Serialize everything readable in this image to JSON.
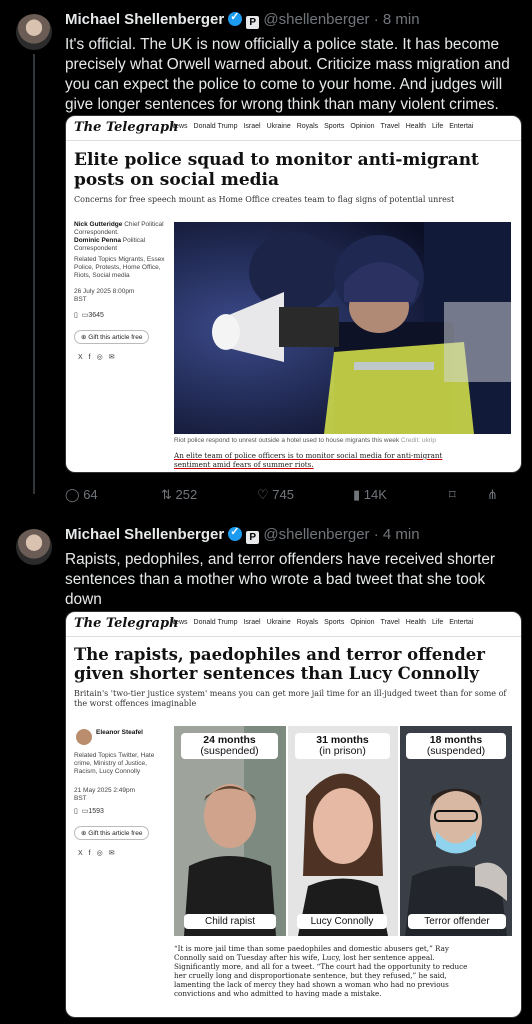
{
  "tweet1": {
    "name": "Michael Shellenberger",
    "badge": "P",
    "handle": "@shellenberger",
    "dot": "·",
    "time": "8 min",
    "text": "It's official. The UK is now officially a police state. It has become precisely what Orwell warned about. Criticize mass migration and you can expect the police to come to your home. And judges will give longer sentences for wrong think than many violent crimes.",
    "article": {
      "logo": "The Telegraph",
      "nav": [
        "News",
        "Donald Trump",
        "Israel",
        "Ukraine",
        "Royals",
        "Sports",
        "Opinion",
        "Travel",
        "Health",
        "Life",
        "Entertai"
      ],
      "headline": "Elite police squad to monitor anti-migrant posts on social media",
      "standfirst": "Concerns for free speech mount as Home Office creates team to flag signs of potential unrest",
      "author1": "Nick Gutteridge",
      "author1_role": "Chief Political Correspondent.",
      "author2": "Dominic Penna",
      "author2_role": "Political Correspondent",
      "topics": "Related Topics Migrants, Essex Police, Protests, Home Office, Riots, Social media",
      "date": "26 July 2025 8:00pm BST",
      "comments": "3645",
      "gift": "Gift this article free",
      "caption": "Riot police respond to unrest outside a hotel used to house migrants this week",
      "credit": "Credit: ukrip",
      "lede": "An elite team of police officers is to monitor social media for anti-migrant sentiment amid fears of summer riots."
    },
    "actions": {
      "replies": "64",
      "reposts": "252",
      "likes": "745",
      "views": "14K"
    }
  },
  "tweet2": {
    "name": "Michael Shellenberger",
    "badge": "P",
    "handle": "@shellenberger",
    "dot": "·",
    "time": "4 min",
    "text": "Rapists, pedophiles, and terror offenders have received shorter sentences than a mother  who wrote a bad tweet that she took down",
    "article": {
      "logo": "The Telegraph",
      "nav": [
        "News",
        "Donald Trump",
        "Israel",
        "Ukraine",
        "Royals",
        "Sports",
        "Opinion",
        "Travel",
        "Health",
        "Life",
        "Entertai"
      ],
      "headline": "The rapists, paedophiles and terror offender given shorter sentences than Lucy Connolly",
      "standfirst": "Britain's 'two-tier justice system' means you can get more jail time for an ill-judged tweet than for some of the worst offences imaginable",
      "author": "Eleanor Steafel",
      "topics": "Related Topics Twitter, Hate crime, Ministry of Justice, Racism, Lucy Connolly",
      "date": "21 May 2025 2:49pm BST",
      "comments": "1593",
      "gift": "Gift this article free",
      "panels": [
        {
          "sentence": "24 months",
          "note": "(suspended)",
          "label": "Child rapist"
        },
        {
          "sentence": "31 months",
          "note": "(in prison)",
          "label": "Lucy Connolly"
        },
        {
          "sentence": "18 months",
          "note": "(suspended)",
          "label": "Terror offender"
        }
      ],
      "body": "“It is more jail time than some paedophiles and domestic abusers get,” Ray Connolly said on Tuesday after his wife, Lucy, lost her sentence appeal. Significantly more, and all for a tweet. “The court had the opportunity to reduce her cruelly long and disproportionate sentence, but they refused,” he said, lamenting the lack of mercy they had shown a woman who had no previous convictions and who admitted to having made a mistake."
    }
  }
}
